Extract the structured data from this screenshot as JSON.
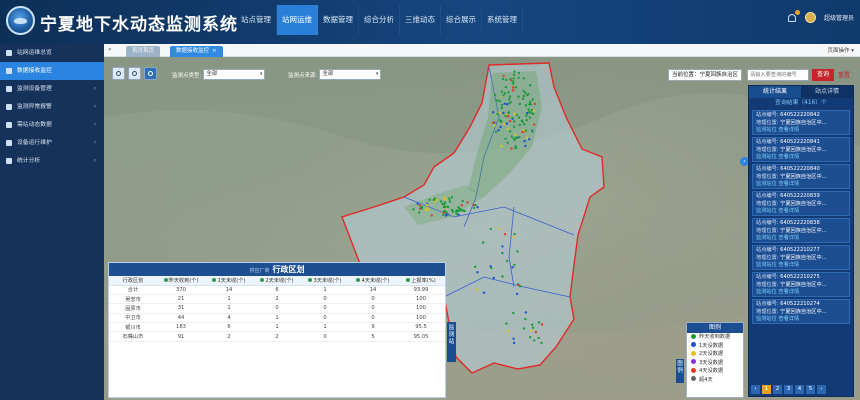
{
  "header": {
    "title": "宁夏地下水动态监测系统",
    "nav": [
      "站点管理",
      "站网运维",
      "数据管理",
      "综合分析",
      "三维动态",
      "综合展示",
      "系统管理"
    ],
    "active_nav": 1,
    "username": "超级管理员"
  },
  "tabs": {
    "home": "首页首页",
    "current": "数据接收监控",
    "close": "×",
    "page_ops": "页面操作 ▾"
  },
  "sidebar": {
    "items": [
      {
        "label": "站网运维总览",
        "arrow": ""
      },
      {
        "label": "数据接收监控",
        "arrow": ""
      },
      {
        "label": "监测设备管理",
        "arrow": "‹"
      },
      {
        "label": "监测异常报警",
        "arrow": "‹"
      },
      {
        "label": "需站动态数据",
        "arrow": "‹"
      },
      {
        "label": "设备运行维护",
        "arrow": "‹"
      },
      {
        "label": "统计分析",
        "arrow": "‹"
      }
    ],
    "active": 1
  },
  "map": {
    "filter1": {
      "label": "监测点类型:",
      "value": "全部"
    },
    "filter2": {
      "label": "监测点来源:",
      "value": "全部"
    },
    "location": "当前位置：宁夏回族自治区",
    "search_placeholder": "请输入要查询的编号",
    "search_label": "查询",
    "clear_label": "重置",
    "side_toggle_label": "监测站",
    "legend_toggle_label": "图例"
  },
  "right_panel": {
    "tabs": [
      "统计结果",
      "站点详情"
    ],
    "count": "查询结果（416）个",
    "cards": [
      {
        "code": "640522220842",
        "addr": "宁夏回族自治区中..."
      },
      {
        "code": "640522220841",
        "addr": "宁夏回族自治区中..."
      },
      {
        "code": "640522220840",
        "addr": "宁夏回族自治区中..."
      },
      {
        "code": "640522220839",
        "addr": "宁夏回族自治区中..."
      },
      {
        "code": "640522220838",
        "addr": "宁夏回族自治区中..."
      },
      {
        "code": "640522210277",
        "addr": "宁夏回族自治区中..."
      },
      {
        "code": "640522210275",
        "addr": "宁夏回族自治区中..."
      },
      {
        "code": "640522210274",
        "addr": "宁夏回族自治区中..."
      }
    ],
    "card_code_label": "站点编号:",
    "card_addr_label": "地理位置:",
    "card_link1": "监测站位",
    "card_link2": "查看详情",
    "pages": [
      "‹",
      "1",
      "2",
      "3",
      "4",
      "5",
      "›"
    ],
    "active_page": 1
  },
  "admin_table": {
    "title_pre": "供应厂商",
    "title": "行政区划",
    "columns": [
      {
        "label": "行政区划",
        "color": ""
      },
      {
        "label": "昨天收到(个)",
        "color": "#2e9e4a"
      },
      {
        "label": "1天未收(个)",
        "color": "#2e9e4a"
      },
      {
        "label": "2天未收(个)",
        "color": "#2e9e4a"
      },
      {
        "label": "3天未收(个)",
        "color": "#2e9e4a"
      },
      {
        "label": "4天未收(个)",
        "color": "#2e9e4a"
      },
      {
        "label": "上报率(%)",
        "color": "#2e9e4a"
      }
    ],
    "rows": [
      [
        "合计",
        "370",
        "14",
        "6",
        "1",
        "14",
        "93.99"
      ],
      [
        "吴忠市",
        "21",
        "1",
        "2",
        "0",
        "0",
        "100"
      ],
      [
        "固原市",
        "31",
        "1",
        "0",
        "0",
        "0",
        "100"
      ],
      [
        "中卫市",
        "44",
        "4",
        "1",
        "0",
        "0",
        "100"
      ],
      [
        "银川市",
        "183",
        "6",
        "1",
        "1",
        "9",
        "95.5"
      ],
      [
        "石嘴山市",
        "91",
        "2",
        "2",
        "0",
        "5",
        "95.05"
      ]
    ]
  },
  "legend": {
    "title": "图例",
    "items": [
      {
        "label": "昨天收到数据",
        "color": "#1a9a3a"
      },
      {
        "label": "1天没数据",
        "color": "#1f4fd0"
      },
      {
        "label": "2天没数据",
        "color": "#e0c21a"
      },
      {
        "label": "3天没数据",
        "color": "#8a2be2"
      },
      {
        "label": "4天没数据",
        "color": "#e03a2a"
      },
      {
        "label": "超4天",
        "color": "#666666"
      }
    ]
  }
}
